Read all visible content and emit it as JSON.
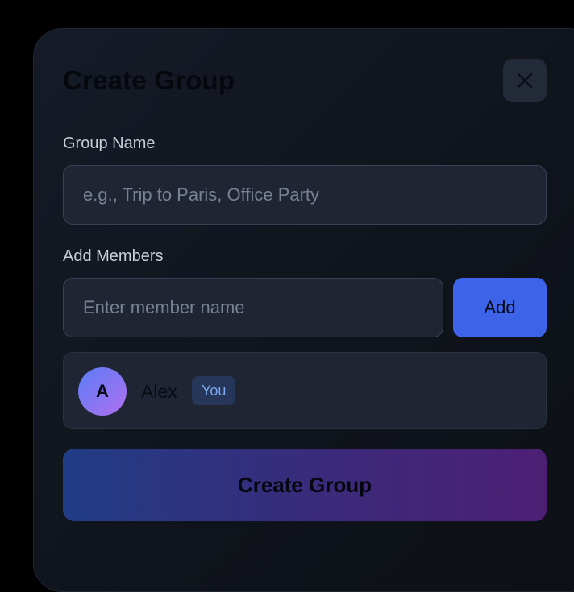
{
  "modal": {
    "title": "Create Group",
    "close_icon": "close-icon"
  },
  "group_name": {
    "label": "Group Name",
    "value": "",
    "placeholder": "e.g., Trip to Paris, Office Party"
  },
  "add_members": {
    "label": "Add Members",
    "input_value": "",
    "input_placeholder": "Enter member name",
    "add_label": "Add"
  },
  "members": [
    {
      "initial": "A",
      "name": "Alex",
      "badge": "You"
    }
  ],
  "submit": {
    "label": "Create Group"
  },
  "colors": {
    "accent": "#3d63e8",
    "badge_text": "#7da6f5",
    "gradient_start": "#213c86",
    "gradient_end": "#4d1f73"
  }
}
